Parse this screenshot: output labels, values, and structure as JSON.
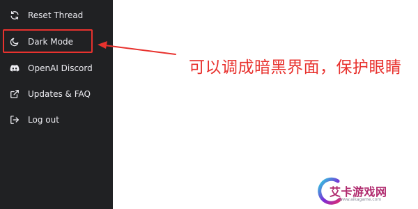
{
  "sidebar": {
    "items": [
      {
        "label": "Reset Thread",
        "icon": "refresh-icon"
      },
      {
        "label": "Dark Mode",
        "icon": "moon-icon"
      },
      {
        "label": "OpenAI Discord",
        "icon": "discord-icon"
      },
      {
        "label": "Updates & FAQ",
        "icon": "external-link-icon"
      },
      {
        "label": "Log out",
        "icon": "logout-icon"
      }
    ]
  },
  "annotation": {
    "text": "可以调成暗黑界面，保护眼睛"
  },
  "watermark": {
    "text": "艾卡游戏网",
    "subtext": "www.aikagame.com"
  },
  "colors": {
    "sidebar_bg": "#202123",
    "sidebar_text": "#ececf1",
    "annotation_red": "#e8322e"
  }
}
